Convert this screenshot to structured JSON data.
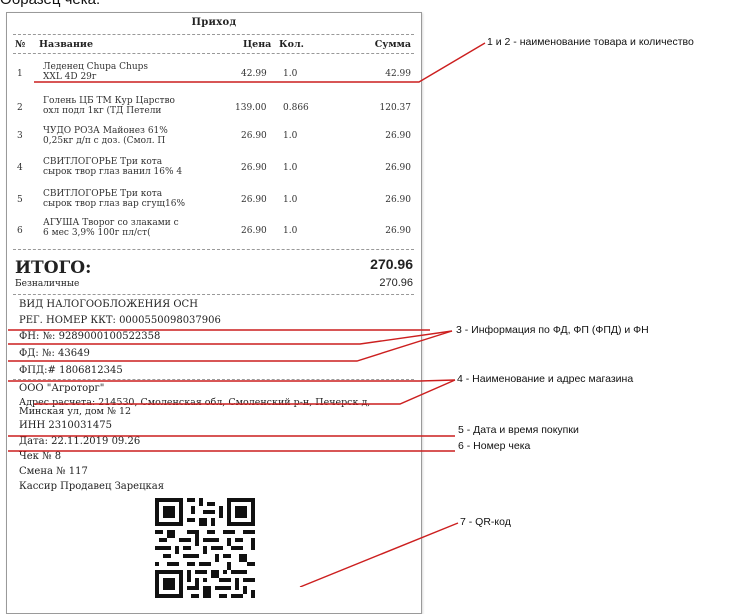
{
  "page_caption": "Образец чека:",
  "receipt": {
    "title": "Приход",
    "headers": {
      "no": "№",
      "name": "Название",
      "price": "Цена",
      "qty": "Кол.",
      "sum": "Сумма"
    },
    "items": [
      {
        "no": "1",
        "name1": "Леденец Chupa Chups",
        "name2": "XXL 4D 29г",
        "price": "42.99",
        "qty": "1.0",
        "sum": "42.99"
      },
      {
        "no": "2",
        "name1": "Голень ЦБ ТМ Кур Царство",
        "name2": "охл подл 1кг (ТД Петели",
        "price": "139.00",
        "qty": "0.866",
        "sum": "120.37"
      },
      {
        "no": "3",
        "name1": "ЧУДО РОЗА Майонез 61%",
        "name2": "0,25кг д/п с доз. (Смол. П",
        "price": "26.90",
        "qty": "1.0",
        "sum": "26.90"
      },
      {
        "no": "4",
        "name1": "СВИТЛОГОРЬЕ Три кота",
        "name2": "сырок твор глаз ванил 16% 4",
        "price": "26.90",
        "qty": "1.0",
        "sum": "26.90"
      },
      {
        "no": "5",
        "name1": "СВИТЛОГОРЬЕ Три кота",
        "name2": "сырок твор глаз вар сгущ16%",
        "price": "26.90",
        "qty": "1.0",
        "sum": "26.90"
      },
      {
        "no": "6",
        "name1": "АГУША Творог со злаками с",
        "name2": "6 мес 3,9% 100г пл/ст(",
        "price": "26.90",
        "qty": "1.0",
        "sum": "26.90"
      }
    ],
    "total_label": "ИТОГО:",
    "total_value": "270.96",
    "cashless_label": "Безналичные",
    "cashless_value": "270.96",
    "tax": "ВИД НАЛОГООБЛОЖЕНИЯ ОСН",
    "kkt": "РЕГ. НОМЕР ККТ: 0000550098037906",
    "fn": "ФН: №: 9289000100522358",
    "fd": "ФД: №: 43649",
    "fpd": "ФПД:# 1806812345",
    "org": "ООО \"Агроторг\"",
    "address1": "Адрес расчета: 214530, Смоленская обл, Смоленский р-н, Печерск д,",
    "address2": "Минская ул, дом № 12",
    "inn": "ИНН 2310031475",
    "date": "Дата: 22.11.2019 09.26",
    "check_no": "Чек № 8",
    "shift": "Смена № 117",
    "cashier": "Кассир Продавец Зарецкая"
  },
  "annotations": {
    "a1": "1 и 2 - наименование товара и количество",
    "a3": "3 - Информация по ФД, ФП (ФПД) и ФН",
    "a4": "4 - Наименование и адрес магазина",
    "a5": "5 - Дата и время покупки",
    "a6": "6 - Номер чека",
    "a7": "7 - QR-код"
  },
  "colors": {
    "annotation_line": "#cc1f1f",
    "paper": "#ffffff",
    "text": "#222222"
  }
}
